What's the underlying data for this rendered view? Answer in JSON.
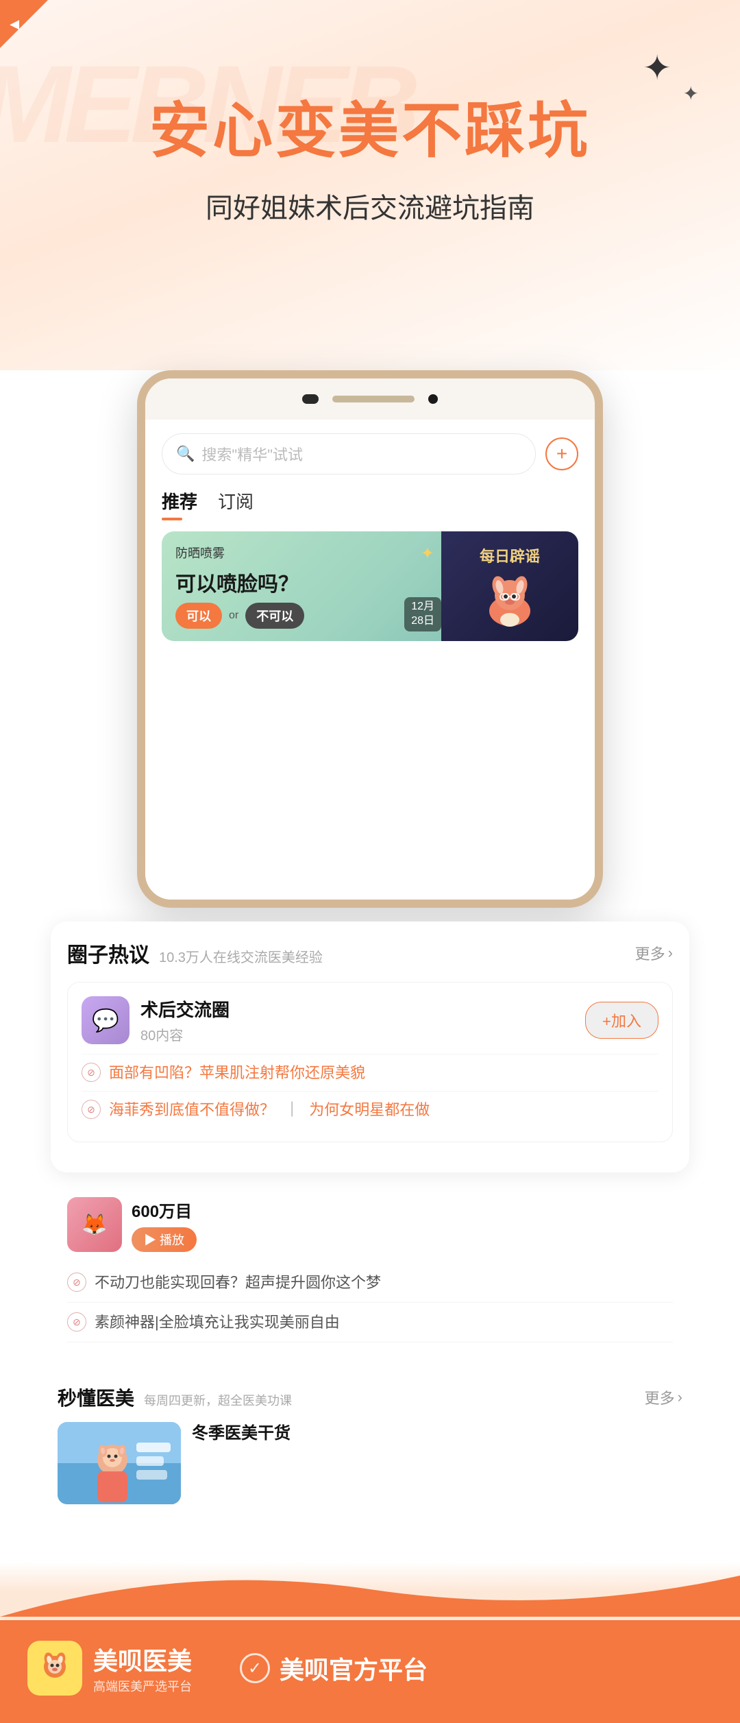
{
  "top": {
    "main_title": "安心变美不踩坑",
    "sub_title": "同好姐妹术后交流避坑指南"
  },
  "phone": {
    "search_placeholder": "搜索\"精华\"试试",
    "tabs": [
      {
        "label": "推荐",
        "active": true
      },
      {
        "label": "订阅",
        "active": false
      }
    ],
    "banner": {
      "tag": "防晒喷雾",
      "main_text": "可以喷脸吗？",
      "btn1": "可以",
      "or": "or",
      "btn2": "不可以",
      "date_line1": "12月",
      "date_line2": "28日",
      "right_label": "每日辟谣"
    }
  },
  "circle": {
    "title": "圈子热议",
    "subtitle": "10.3万人在线交流医美经验",
    "more": "更多",
    "card": {
      "name": "术后交流圈",
      "count": "80内容",
      "join": "+加入"
    },
    "posts": [
      {
        "text": "面部有凹陷？苹果肌注射帮你还原美貌"
      },
      {
        "text1": "海菲秀到底值不值得做？",
        "mark": "？",
        "sep": "|",
        "text2": "为何女明星都在做"
      }
    ]
  },
  "mid_posts": [
    {
      "text": "不动刀也能实现回春？超声提升圆你这个梦"
    },
    {
      "text": "素颜神器|全脸填充让我实现美丽自由"
    }
  ],
  "know": {
    "title": "秒懂医美",
    "subtitle": "每周四更新，超全医美功课",
    "more": "更多",
    "card_title": "冬季医美干货"
  },
  "bottom": {
    "brand_name": "美呗医美",
    "brand_tagline": "高端医美严选平台",
    "official_label": "美呗官方平台"
  }
}
